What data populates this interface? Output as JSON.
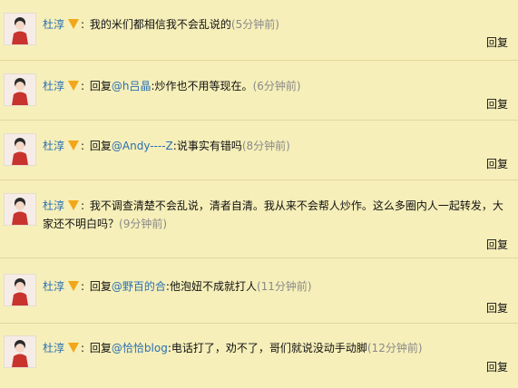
{
  "reply_label": "回复",
  "vip_icon": "vip-v-icon",
  "comments": [
    {
      "author": "杜淳",
      "text": "我的米们都相信我不会乱说的",
      "time": "(5分钟前)"
    },
    {
      "author": "杜淳",
      "prefix": "回复",
      "mention": "@h吕晶",
      "text": ":炒作也不用等现在。",
      "time": "(6分钟前)"
    },
    {
      "author": "杜淳",
      "prefix": "回复",
      "mention": "@Andy----Z",
      "text": ":说事实有错吗",
      "time": "(8分钟前)"
    },
    {
      "author": "杜淳",
      "text": "我不调查清楚不会乱说，清者自清。我从来不会帮人炒作。这么多圈内人一起转发，大家还不明白吗？",
      "time": "(9分钟前)"
    },
    {
      "author": "杜淳",
      "prefix": "回复",
      "mention": "@野百的合",
      "text": ":他泡妞不成就打人",
      "time": "(11分钟前)"
    },
    {
      "author": "杜淳",
      "prefix": "回复",
      "mention": "@恰恰blog",
      "text": ":电话打了，劝不了，哥们就说没动手动脚",
      "time": "(12分钟前)"
    }
  ]
}
